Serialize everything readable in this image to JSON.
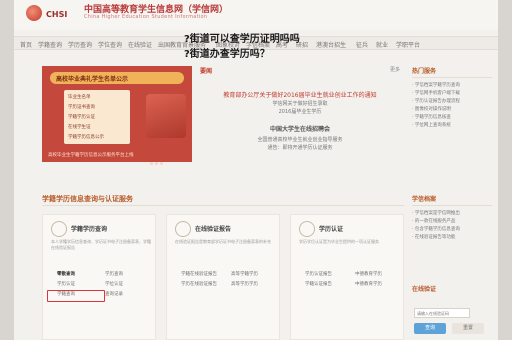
{
  "header": {
    "logo_text": "CHSI",
    "site_title": "中国高等教育学生信息网（学信网）",
    "site_subtitle": "China Higher Education Student Information"
  },
  "nav": [
    "首页",
    "学籍查询",
    "学历查询",
    "学位查询",
    "在线验证",
    "出国教育背景服务",
    "图象校对",
    "学信档案",
    "高考",
    "研招",
    "港澳台招生",
    "征兵",
    "就业",
    "学职平台"
  ],
  "question": {
    "line1": "?街道可以查学历证明吗吗",
    "line2": "?街道办查学历吗？"
  },
  "banner": {
    "title": "高校毕业典礼学生名单公示",
    "lines": [
      "毕业生名单",
      "学历证书查询",
      "学籍学历认证",
      "在线学生证",
      "学籍学历信息公示"
    ],
    "bottom": "高校毕业生学籍学历信息公示服务平台上线"
  },
  "notice": {
    "tab": "要闻",
    "more": "更多",
    "lines": [
      "教育部办公厅关于做好2016届毕业生就业创业工作的通知",
      "学信网关于做好招生录取",
      "2016届毕业生学历",
      "中国大学生在线招聘会",
      "全国普通高校毕业生就业创业指导服务",
      "通告：即将开通学历认证服务"
    ]
  },
  "right_col": {
    "title": "热门服务",
    "items": [
      "· 学信档案学籍学历查询",
      "· 学信网手机客户端下载",
      "· 学历认证报告办理流程",
      "· 图像校对操作说明",
      "· 学籍学历信息核查",
      "· 学位网上查询系统"
    ]
  },
  "section": {
    "title": "学籍学历信息查询与认证服务"
  },
  "services": [
    {
      "name": "学籍学历查询",
      "desc": "本人学籍学历信息查询、学历证书电子注册备案表、学籍在线验证报告",
      "links": [
        "零散查询",
        "学历认证",
        "学籍查询",
        "学历查询",
        "学位认证",
        "查询记录"
      ]
    },
    {
      "name": "在线验证报告",
      "desc": "在线验证报告是教育部学历证书电子注册备案表的补充",
      "links": [
        "学籍在线验证报告",
        "学历在线验证报告",
        "高等学籍学历",
        "高等学历学历"
      ]
    },
    {
      "name": "学历认证",
      "desc": "学历学位认证是为毕业生提供的一项认证服务",
      "links": [
        "学历认证报告",
        "学籍认证报告",
        "中德教育学历",
        "中德教育学历"
      ]
    }
  ],
  "right_col2": {
    "title": "学信档案",
    "items": [
      "· 学信档案是学信网推出",
      "· 的一款在线服务产品",
      "· 包含学籍学历信息查询",
      "· 在线验证报告等功能"
    ]
  },
  "online": {
    "title": "在线验证",
    "placeholder": "请输入在线验证码",
    "verify": "查询",
    "reset": "重置"
  },
  "highlight_label": "学历查询"
}
